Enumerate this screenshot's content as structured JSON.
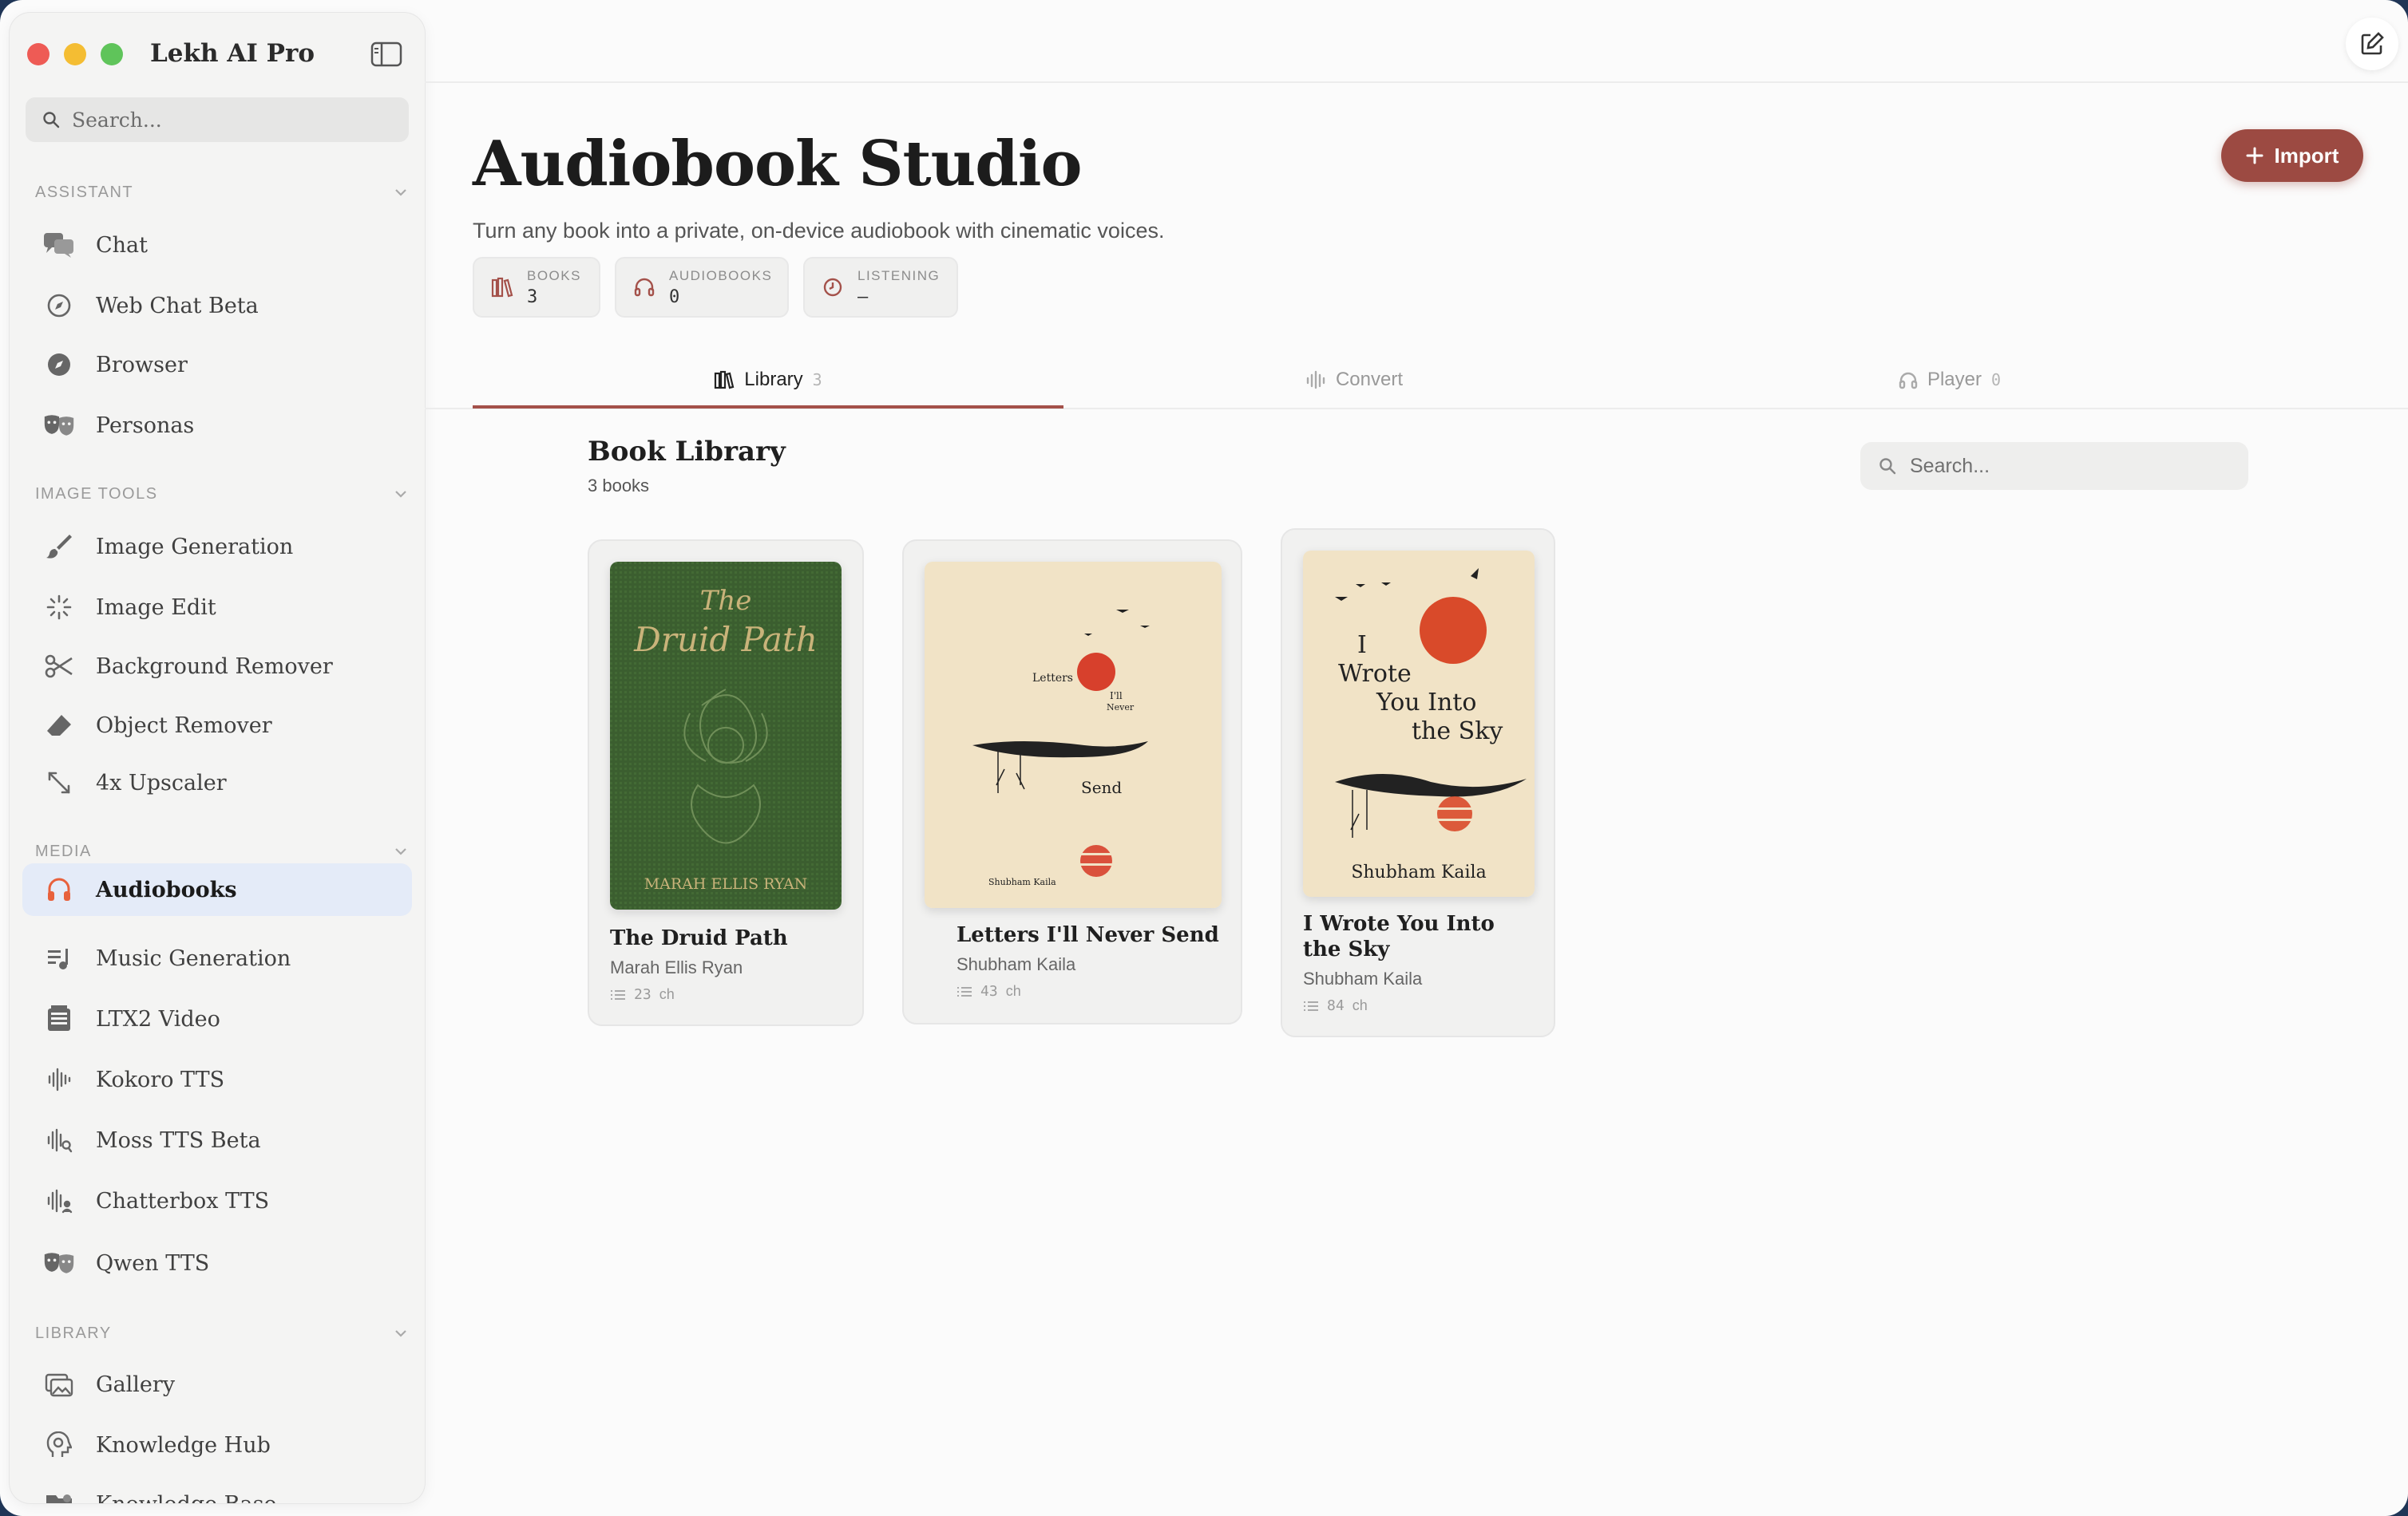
{
  "app": {
    "title": "Lekh AI Pro"
  },
  "sidebar": {
    "search_placeholder": "Search...",
    "sections": [
      {
        "label": "ASSISTANT",
        "items": [
          "Chat",
          "Web Chat Beta",
          "Browser",
          "Personas"
        ]
      },
      {
        "label": "IMAGE TOOLS",
        "items": [
          "Image Generation",
          "Image Edit",
          "Background Remover",
          "Object Remover",
          "4x Upscaler"
        ]
      },
      {
        "label": "MEDIA",
        "items": [
          "Audiobooks",
          "Music Generation",
          "LTX2 Video",
          "Kokoro TTS",
          "Moss TTS Beta",
          "Chatterbox TTS",
          "Qwen TTS"
        ]
      },
      {
        "label": "LIBRARY",
        "items": [
          "Gallery",
          "Knowledge Hub",
          "Knowledge Base"
        ]
      }
    ],
    "active_item": "Audiobooks"
  },
  "page": {
    "title": "Audiobook Studio",
    "subtitle": "Turn any book into a private, on-device audiobook with cinematic voices.",
    "import_label": "Import",
    "stats": [
      {
        "key": "BOOKS",
        "value": "3"
      },
      {
        "key": "AUDIOBOOKS",
        "value": "0"
      },
      {
        "key": "LISTENING",
        "value": "—"
      }
    ]
  },
  "tabs": [
    {
      "label": "Library",
      "count": "3"
    },
    {
      "label": "Convert",
      "count": ""
    },
    {
      "label": "Player",
      "count": "0"
    }
  ],
  "library": {
    "title": "Book Library",
    "count": "3 books",
    "search_placeholder": "Search...",
    "books": [
      {
        "title": "The Druid Path",
        "author": "Marah Ellis Ryan",
        "chapters": "23",
        "ch_unit": "ch",
        "cover_lines": [
          "The",
          "Druid Path"
        ],
        "cover_author": "MARAH ELLIS RYAN"
      },
      {
        "title": "Letters I'll Never Send",
        "author": "Shubham Kaila",
        "chapters": "43",
        "ch_unit": "ch",
        "cover_lines": [
          "Letters",
          "I'll",
          "Never",
          "Send"
        ],
        "cover_author": "Shubham Kaila"
      },
      {
        "title": "I Wrote You Into the Sky",
        "title_lines": [
          "I Wrote You Into",
          "the Sky"
        ],
        "author": "Shubham Kaila",
        "chapters": "84",
        "ch_unit": "ch",
        "cover_lines": [
          "I",
          "Wrote",
          "You Into",
          "the Sky"
        ],
        "cover_author": "Shubham Kaila"
      }
    ]
  },
  "colors": {
    "accent": "#9c4a42",
    "active_bg": "#e4ebf8",
    "audiobook_icon": "#e8613c"
  }
}
